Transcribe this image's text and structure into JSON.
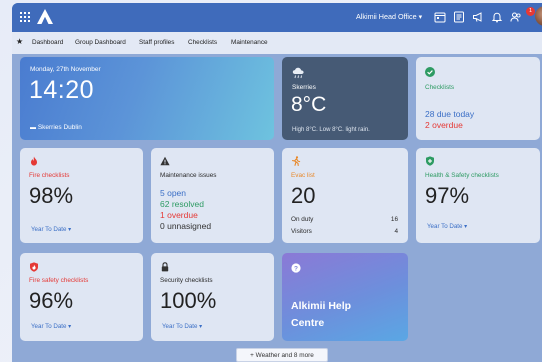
{
  "topbar": {
    "org_selector": "Alkimii Head Office ▾",
    "notification_count": "1",
    "icons": [
      "apps-grid-icon",
      "alkimii-logo",
      "calendar-icon",
      "document-icon",
      "megaphone-icon",
      "bell-icon",
      "people-icon"
    ]
  },
  "nav": {
    "items": [
      "Dashboard",
      "Group Dashboard",
      "Staff profiles",
      "Checklists",
      "Maintenance"
    ]
  },
  "clock": {
    "date": "Monday, 27th November",
    "time": "14:20",
    "location": "Skerries Dublin"
  },
  "weather": {
    "place": "Skerries",
    "temp": "8°C",
    "desc": "High 8°C. Low 8°C. light rain."
  },
  "checklists": {
    "title": "Checklists",
    "due": "28 due today",
    "overdue": "2 overdue",
    "title_color": "#2e9b63",
    "due_color": "#3b6fc6",
    "overdue_color": "#e53935"
  },
  "fire": {
    "title": "Fire checklists",
    "value": "98%",
    "period": "Year To Date ▾",
    "color": "#e53935"
  },
  "maintenance": {
    "title": "Maintenance issues",
    "open": "5 open",
    "resolved": "62 resolved",
    "overdue": "1 overdue",
    "unassigned": "0 unnasigned"
  },
  "evac": {
    "title": "Evac list",
    "value": "20",
    "rows": [
      {
        "label": "On duty",
        "value": "16"
      },
      {
        "label": "Visitors",
        "value": "4"
      }
    ],
    "color": "#e8892b"
  },
  "health_safety": {
    "title": "Health & Safety checklists",
    "value": "97%",
    "period": "Year To Date ▾",
    "color": "#2e9b63"
  },
  "fire_safety": {
    "title": "Fire safety checklists",
    "value": "96%",
    "period": "Year To Date ▾",
    "color": "#e53935"
  },
  "security": {
    "title": "Security checklists",
    "value": "100%",
    "period": "Year To Date ▾"
  },
  "help": {
    "title_line1": "Alkimii Help",
    "title_line2": "Centre"
  },
  "more_button": "+ Weather and 8 more"
}
